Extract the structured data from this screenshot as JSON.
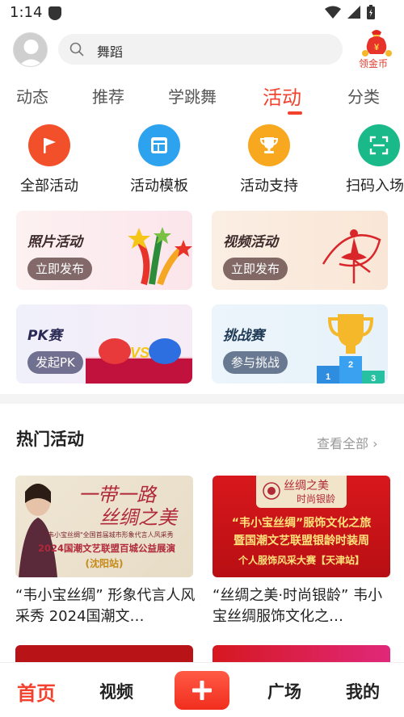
{
  "status_bar": {
    "time": "1:14"
  },
  "header": {
    "search_text": "舞蹈",
    "coin_label": "领金币"
  },
  "tabs": [
    {
      "label": "动态",
      "active": false
    },
    {
      "label": "推荐",
      "active": false
    },
    {
      "label": "学跳舞",
      "active": false
    },
    {
      "label": "活动",
      "active": true
    },
    {
      "label": "分类",
      "active": false
    }
  ],
  "quick_icons": [
    {
      "label": "全部活动",
      "icon": "flag-icon",
      "color": "#f2502a"
    },
    {
      "label": "活动模板",
      "icon": "template-icon",
      "color": "#2da3f0"
    },
    {
      "label": "活动支持",
      "icon": "trophy-icon",
      "color": "#f7a81e"
    },
    {
      "label": "扫码入场",
      "icon": "scan-icon",
      "color": "#19b98a"
    }
  ],
  "cards": [
    {
      "title": "照片活动",
      "button": "立即发布"
    },
    {
      "title": "视频活动",
      "button": "立即发布"
    },
    {
      "title": "PK赛",
      "button": "发起PK"
    },
    {
      "title": "挑战赛",
      "button": "参与挑战"
    }
  ],
  "hot": {
    "title": "热门活动",
    "view_all": "查看全部",
    "items": [
      {
        "image_text_1": "一带一路",
        "image_text_2": "丝绸之美",
        "image_text_3": "\"韦小宝丝绸\"全国首届城市形象代言人风采秀",
        "image_text_4": "2024国潮文艺联盟百城公益展演",
        "image_text_5": "(沈阳站)",
        "caption": "“韦小宝丝绸” 形象代言人风采秀 2024国潮文…"
      },
      {
        "image_text_1": "丝绸之美",
        "image_text_2": "时尚银龄",
        "image_text_3": "“韦小宝丝绸”服饰文化之旅",
        "image_text_4": "暨国潮文艺联盟银龄时装周",
        "image_text_5": "个人服饰风采大赛【天津站】",
        "caption": "“丝绸之美·时尚银龄” 韦小宝丝绸服饰文化之…"
      }
    ]
  },
  "bottom_nav": [
    {
      "label": "首页",
      "active": true
    },
    {
      "label": "视频",
      "active": false
    },
    {
      "label": "广场",
      "active": false
    },
    {
      "label": "我的",
      "active": false
    }
  ],
  "colors": {
    "accent": "#f2412d"
  }
}
